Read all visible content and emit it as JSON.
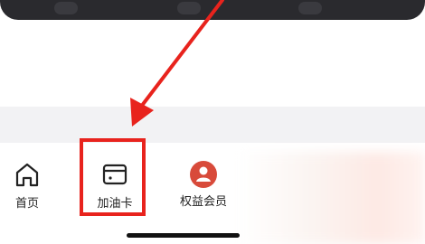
{
  "tabbar": {
    "items": [
      {
        "label": "首页",
        "icon": "home-icon"
      },
      {
        "label": "加油卡",
        "icon": "card-icon"
      },
      {
        "label": "权益会员",
        "icon": "member-icon"
      }
    ]
  },
  "annotation": {
    "highlight_color": "#e8231d",
    "target": "加油卡"
  },
  "colors": {
    "accent_red": "#e8231d",
    "member_badge": "#d84a3a",
    "section_band": "#f2f2f4"
  }
}
